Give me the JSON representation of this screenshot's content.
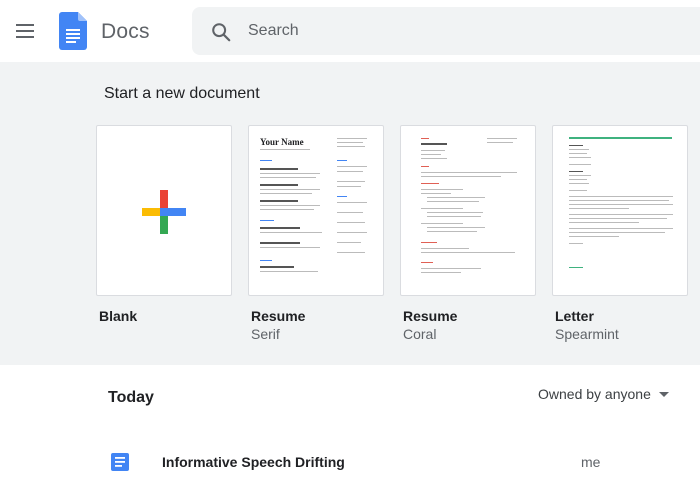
{
  "header": {
    "app_title": "Docs",
    "search_placeholder": "Search"
  },
  "gallery": {
    "title": "Start a new document",
    "templates": [
      {
        "name": "Blank",
        "subtitle": ""
      },
      {
        "name": "Resume",
        "subtitle": "Serif",
        "thumb_heading": "Your Name"
      },
      {
        "name": "Resume",
        "subtitle": "Coral"
      },
      {
        "name": "Letter",
        "subtitle": "Spearmint"
      }
    ]
  },
  "list": {
    "section_title": "Today",
    "owner_filter": "Owned by anyone",
    "documents": [
      {
        "name": "Informative Speech Drifting",
        "owner": "me"
      }
    ]
  },
  "colors": {
    "docs_blue": "#4285f4",
    "gallery_bg": "#f1f3f4",
    "plus_blue": "#4285f4",
    "plus_red": "#ea4335",
    "plus_yellow": "#fbbc04",
    "plus_green": "#34a853",
    "coral": "#e06055",
    "spearmint": "#3fb27f"
  },
  "icons": {
    "menu": "hamburger-menu-icon",
    "logo": "docs-logo-icon",
    "search": "search-icon",
    "plus": "plus-icon",
    "doc": "document-icon",
    "caret": "caret-down-icon"
  }
}
